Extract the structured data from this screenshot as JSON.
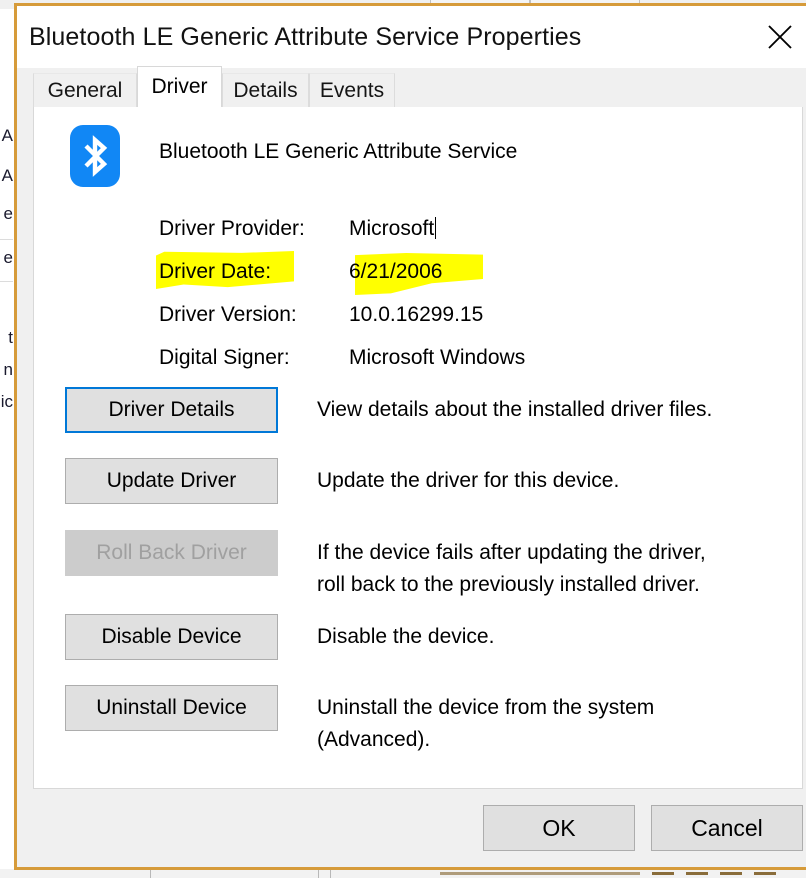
{
  "window": {
    "title": "Bluetooth LE Generic Attribute Service Properties",
    "close_label": "✕"
  },
  "tabs": [
    {
      "label": "General",
      "active": false
    },
    {
      "label": "Driver",
      "active": true
    },
    {
      "label": "Details",
      "active": false
    },
    {
      "label": "Events",
      "active": false
    }
  ],
  "device": {
    "icon": "bluetooth-icon",
    "name": "Bluetooth LE Generic Attribute Service"
  },
  "properties": [
    {
      "label": "Driver Provider:",
      "value": "Microsoft",
      "caret": true,
      "highlighted": false
    },
    {
      "label": "Driver Date:",
      "value": "6/21/2006",
      "caret": false,
      "highlighted": true
    },
    {
      "label": "Driver Version:",
      "value": "10.0.16299.15",
      "caret": false,
      "highlighted": false
    },
    {
      "label": "Digital Signer:",
      "value": "Microsoft Windows",
      "caret": false,
      "highlighted": false
    }
  ],
  "actions": [
    {
      "label": "Driver Details",
      "description": "View details about the installed driver files.",
      "state": "focused"
    },
    {
      "label": "Update Driver",
      "description": "Update the driver for this device.",
      "state": "normal"
    },
    {
      "label": "Roll Back Driver",
      "description": "If the device fails after updating the driver, roll back to the previously installed driver.",
      "state": "disabled"
    },
    {
      "label": "Disable Device",
      "description": "Disable the device.",
      "state": "normal"
    },
    {
      "label": "Uninstall Device",
      "description": "Uninstall the device from the system (Advanced).",
      "state": "normal"
    }
  ],
  "footer": {
    "ok_label": "OK",
    "cancel_label": "Cancel"
  },
  "background": {
    "fragments": [
      "A",
      "e",
      "e",
      "t",
      "n",
      "ic"
    ]
  },
  "colors": {
    "window_border": "#d69b3a",
    "accent_focus": "#0078d7",
    "highlighter": "#ffff00",
    "bluetooth_blue": "#1187f5",
    "button_face": "#e0e0e0",
    "dialog_face": "#f0f0f0"
  }
}
